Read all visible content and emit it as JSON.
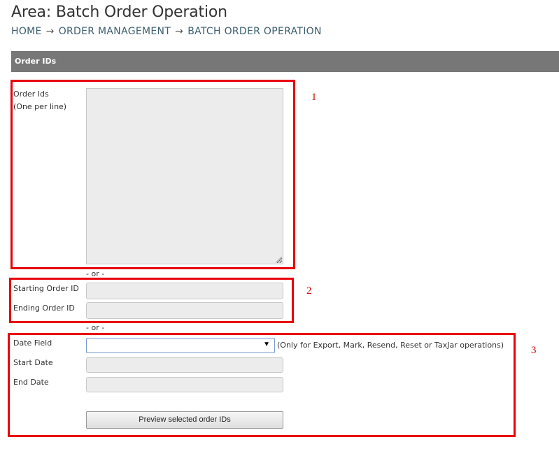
{
  "page": {
    "title": "Area: Batch Order Operation",
    "breadcrumb": {
      "home": "HOME",
      "section": "ORDER MANAGEMENT",
      "current": "BATCH ORDER OPERATION",
      "separator": "→"
    },
    "section_header": "Order IDs"
  },
  "form": {
    "order_ids_label_line1": "Order Ids",
    "order_ids_label_line2": "(One per line)",
    "order_ids_value": "",
    "or_separator_1": "- or -",
    "starting_order_id_label": "Starting Order ID",
    "starting_order_id_value": "",
    "ending_order_id_label": "Ending Order ID",
    "ending_order_id_value": "",
    "or_separator_2": "- or -",
    "date_field_label": "Date Field",
    "date_field_selected": "",
    "date_field_note": "(Only for Export, Mark, Resend, Reset or TaxJar operations)",
    "start_date_label": "Start Date",
    "start_date_value": "",
    "end_date_label": "End Date",
    "end_date_value": "",
    "preview_button_label": "Preview selected order IDs"
  },
  "annotations": {
    "box1_number": "1",
    "box2_number": "2",
    "box3_number": "3",
    "color": "#e8000b"
  }
}
